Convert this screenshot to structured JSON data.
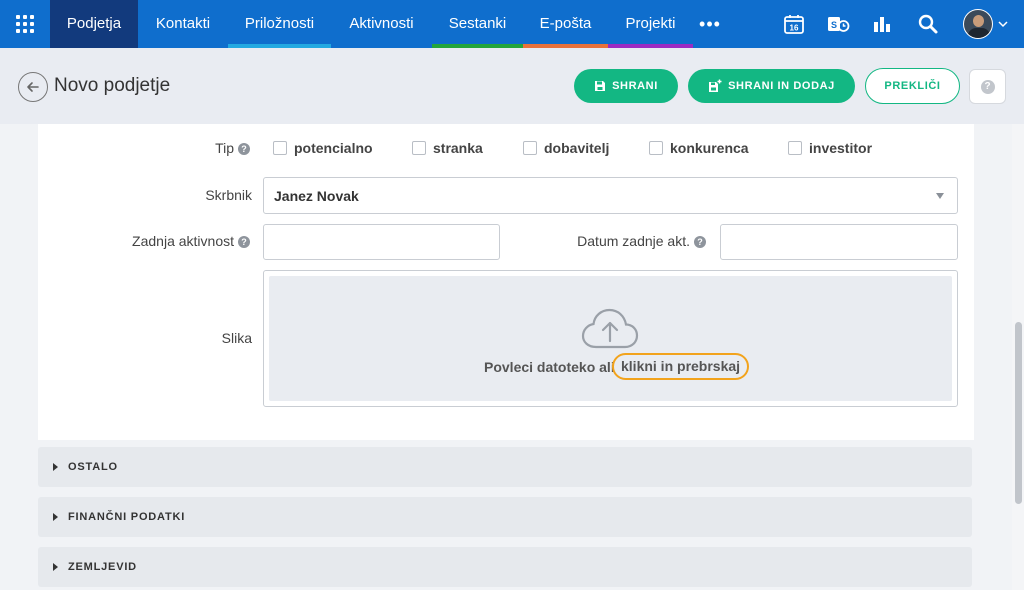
{
  "nav": {
    "tabs": [
      {
        "label": "Podjetja",
        "color": "#123a7d"
      },
      {
        "label": "Kontakti",
        "color": "#0f6ecd"
      },
      {
        "label": "Priložnosti",
        "color": "#23a9e1"
      },
      {
        "label": "Aktivnosti",
        "color": "#0f6ecd"
      },
      {
        "label": "Sestanki",
        "color": "#23a53c"
      },
      {
        "label": "E-pošta",
        "color": "#e8713a"
      },
      {
        "label": "Projekti",
        "color": "#9b2bc3"
      }
    ],
    "more_label": "•••",
    "calendar_day": "16"
  },
  "header": {
    "title": "Novo podjetje",
    "save_label": "SHRANI",
    "save_add_label": "SHRANI IN DODAJ",
    "cancel_label": "PREKLIČI"
  },
  "form": {
    "type_label": "Tip",
    "type_options": [
      "potencialno",
      "stranka",
      "dobavitelj",
      "konkurenca",
      "investitor"
    ],
    "owner_label": "Skrbnik",
    "owner_value": "Janez Novak",
    "last_activity_label": "Zadnja aktivnost",
    "last_activity_date_label": "Datum zadnje akt.",
    "image_label": "Slika",
    "dropzone_text": "Povleci datoteko ali",
    "dropzone_link": "klikni in prebrskaj"
  },
  "sections": [
    "OSTALO",
    "FINANČNI PODATKI",
    "ZEMLJEVID"
  ],
  "colors": {
    "accent_green": "#13b783",
    "nav_blue": "#0f6ecd",
    "highlight_orange": "#f2a31c"
  }
}
